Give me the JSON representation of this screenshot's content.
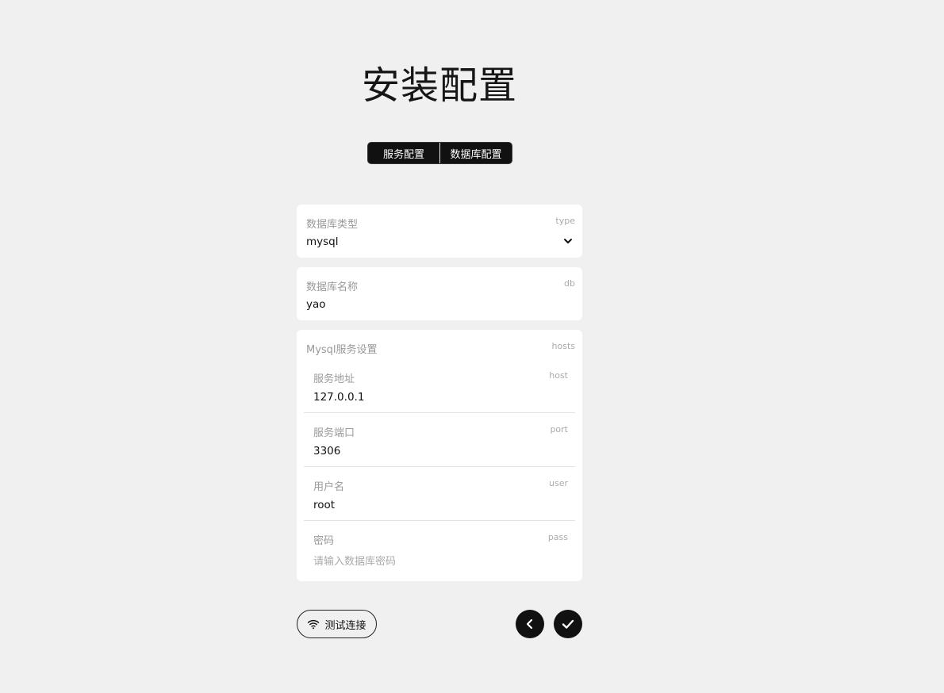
{
  "title": "安装配置",
  "tabs": [
    {
      "label": "服务配置"
    },
    {
      "label": "数据库配置"
    }
  ],
  "fields": {
    "type": {
      "label": "数据库类型",
      "key": "type",
      "value": "mysql"
    },
    "db": {
      "label": "数据库名称",
      "key": "db",
      "value": "yao"
    }
  },
  "hosts": {
    "label": "Mysql服务设置",
    "key": "hosts",
    "rows": [
      {
        "label": "服务地址",
        "key": "host",
        "value": "127.0.0.1",
        "placeholder": ""
      },
      {
        "label": "服务端口",
        "key": "port",
        "value": "3306",
        "placeholder": ""
      },
      {
        "label": "用户名",
        "key": "user",
        "value": "root",
        "placeholder": ""
      },
      {
        "label": "密码",
        "key": "pass",
        "value": "",
        "placeholder": "请输入数据库密码"
      }
    ]
  },
  "actions": {
    "test_label": "测试连接",
    "test_icon": "wifi-icon",
    "back_icon": "chevron-left-icon",
    "confirm_icon": "check-icon"
  },
  "colors": {
    "background": "#f0f0f0",
    "accent": "#111111",
    "card": "#ffffff",
    "muted": "#999999"
  }
}
